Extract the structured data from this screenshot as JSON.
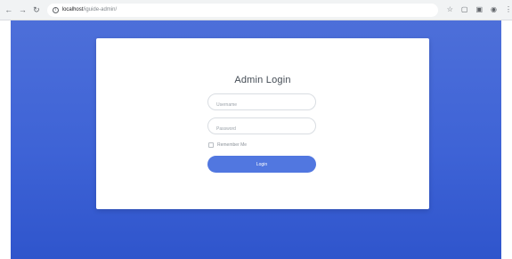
{
  "browser": {
    "url_host": "localhost",
    "url_path": "/iguide-admin/"
  },
  "login": {
    "title": "Admin Login",
    "username_placeholder": "Username",
    "password_placeholder": "Password",
    "remember_label": "Remember Me",
    "button_label": "Login"
  },
  "colors": {
    "background_top": "#4d6fd9",
    "background_bottom": "#2f55cc",
    "button": "#5177e0"
  }
}
